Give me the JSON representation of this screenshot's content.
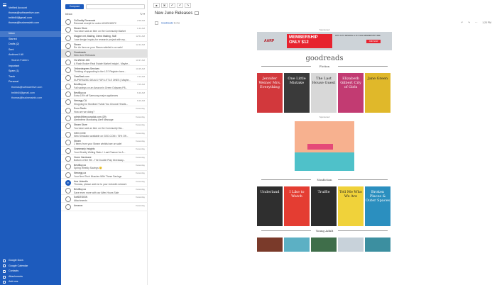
{
  "nav": {
    "accounts": [
      "Verified Account",
      "thomas@softwarehive.com",
      "tmlbb64@gmail.com",
      "thomas@businessinfo.com"
    ],
    "folders": [
      {
        "label": "Inbox",
        "selected": true
      },
      {
        "label": "Starred"
      },
      {
        "label": "Drafts (2)"
      },
      {
        "label": "Sent"
      },
      {
        "label": "Archived / All"
      },
      {
        "label": "Search Folders",
        "sub": true
      },
      {
        "label": "Important"
      },
      {
        "label": "Spam (1)"
      },
      {
        "label": "Trash"
      },
      {
        "label": "Personal"
      },
      {
        "label": "thomas@softwarehive.com",
        "sub": true
      },
      {
        "label": "tmlbb64@gmail.com",
        "sub": true
      },
      {
        "label": "thomas@businessinfo.com",
        "sub": true
      }
    ],
    "bottom": [
      "Google Docs",
      "Google Calendar",
      "Contacts",
      "Attachments",
      "Add-ons"
    ]
  },
  "list": {
    "compose_label": "Compose",
    "folder_label": "Inbox",
    "refresh_icon": "refresh-icon",
    "rows": [
      {
        "from": "GoDaddy Renewals",
        "subject": "Renewal receipt for order #1020015572",
        "time": "2:58 AM"
      },
      {
        "from": "Steam Store",
        "subject": "You have sold an item on the Community Market",
        "time": "1:42 AM"
      },
      {
        "from": "Magpie.net, Mailing, Direct Mailing, 9AE",
        "subject": "I use design inquiry for research project with my...",
        "time": "12:51 AM"
      },
      {
        "from": "Steam",
        "subject": "Re: An item on your Steam wishlist is on sale!",
        "time": "12:44 AM"
      },
      {
        "from": "Goodreads",
        "subject": "New June Releases",
        "time": "",
        "selected": true
      },
      {
        "from": "Via Weber 426",
        "subject": "A Flash Broker Real Estate Market Insight - Maybe...",
        "time": "10:37 AM"
      },
      {
        "from": "Onlinedegrees Services",
        "subject": "Thinking of upgrading to the LG? Register here...",
        "time": "10:45 AM"
      },
      {
        "from": "GearBest.com",
        "subject": "SUPERSIZED DEALS FOR LITTLE ONES | Maybe...",
        "time": "7:23 AM"
      },
      {
        "from": "BestBuy.ca",
        "subject": "Fall savings on an Amazon's Green Odyssey P8...",
        "time": "7:05 AM"
      },
      {
        "from": "BestBuy.ca",
        "subject": "Extra 10% off Samsung major appliances",
        "time": "6:40 AM"
      },
      {
        "from": "Newegg CA",
        "subject": "Shopping for Monitors? Must You Choose Hearts...",
        "time": "6:26 AM"
      },
      {
        "from": "Even Radio",
        "subject": "How are we doing?",
        "time": "Yesterday"
      },
      {
        "from": "admin@thecouraduk.com (29)",
        "subject": "Alertmeme Monitoring Alert Message",
        "time": "Yesterday"
      },
      {
        "from": "Steam Store",
        "subject": "You have sold an item on the Community Ma...",
        "time": "Yesterday"
      },
      {
        "from": "GEO.COM",
        "subject": "New Simulator available on GEO.COM • 75% Off...",
        "time": "Yesterday"
      },
      {
        "from": "Steam",
        "subject": "2 items from your Steam wishlist are on sale!",
        "time": "Yesterday"
      },
      {
        "from": "Grammarly Insights",
        "subject": "Your Weekly Writing Stats + Last Chance for A...",
        "time": "Yesterday"
      },
      {
        "from": "Home Hardware",
        "subject": "Bottom of the 9th - The Double Play Giveaway...",
        "time": "Yesterday"
      },
      {
        "from": "BestBuy.ca",
        "subject": "Spring Weekly Savings 😊",
        "time": "Yesterday"
      },
      {
        "from": "Newegg.ca",
        "subject": "Your Next Tech Muscles With These Savings",
        "time": "Yesterday"
      },
      {
        "from": "Ana LinkedIn",
        "subject": "Thomas, please add me to your LinkedIn network",
        "time": "Yesterday",
        "badge": "in"
      },
      {
        "from": "BestBuy.ca",
        "subject": "Save even more with our After-Hours Sale",
        "time": "Yesterday"
      },
      {
        "from": "SoftDESIGN",
        "subject": "Attachments",
        "time": "Yesterday"
      },
      {
        "from": "Amazon",
        "subject": "",
        "time": "Yesterday"
      }
    ]
  },
  "pane": {
    "subject": "New June Releases",
    "sender": "Goodreads",
    "sender_suffix": "to me",
    "time_label": "1:20 PM",
    "email": {
      "sponsored": "Sponsored",
      "ad1": {
        "brand": "AARP",
        "headline_1": "MEMBERSHIP",
        "headline_2": "ONLY $12",
        "fine": "WITH AUTO RENEWAL & 1ST-YEAR MEMBERSHIP FREE",
        "cta": "JOIN NOW"
      },
      "logo": "goodreads",
      "section_fiction": "Fiction",
      "fiction_books": [
        {
          "title": "Jennifer Weiner Mrs. Everything",
          "color": "#d2383c"
        },
        {
          "title": "One Little Mistake",
          "color": "#3a3a3a"
        },
        {
          "title": "The Last House Guest",
          "color": "#d8d8d8"
        },
        {
          "title": "Elizabeth Gilbert City of Girls",
          "color": "#c23b72"
        },
        {
          "title": "Jane Green",
          "color": "#e0b82a"
        }
      ],
      "ad2_sponsored": "Sponsored",
      "section_nonfiction": "Nonfiction",
      "nonfiction_books": [
        {
          "title": "Underland",
          "color": "#2f2f2f"
        },
        {
          "title": "I Like to Watch",
          "color": "#e43d32"
        },
        {
          "title": "Truffle",
          "color": "#2c2c2c"
        },
        {
          "title": "Tell Me Who We Are",
          "color": "#f0d23a"
        },
        {
          "title": "Broken Places & Outer Spaces",
          "color": "#2b8fbf"
        }
      ],
      "section_ya": "Young Adult",
      "ya_colors": [
        "#7a3a2a",
        "#5cb0c4",
        "#3f6e4a",
        "#c8d2da",
        "#3c8fa0"
      ]
    }
  }
}
